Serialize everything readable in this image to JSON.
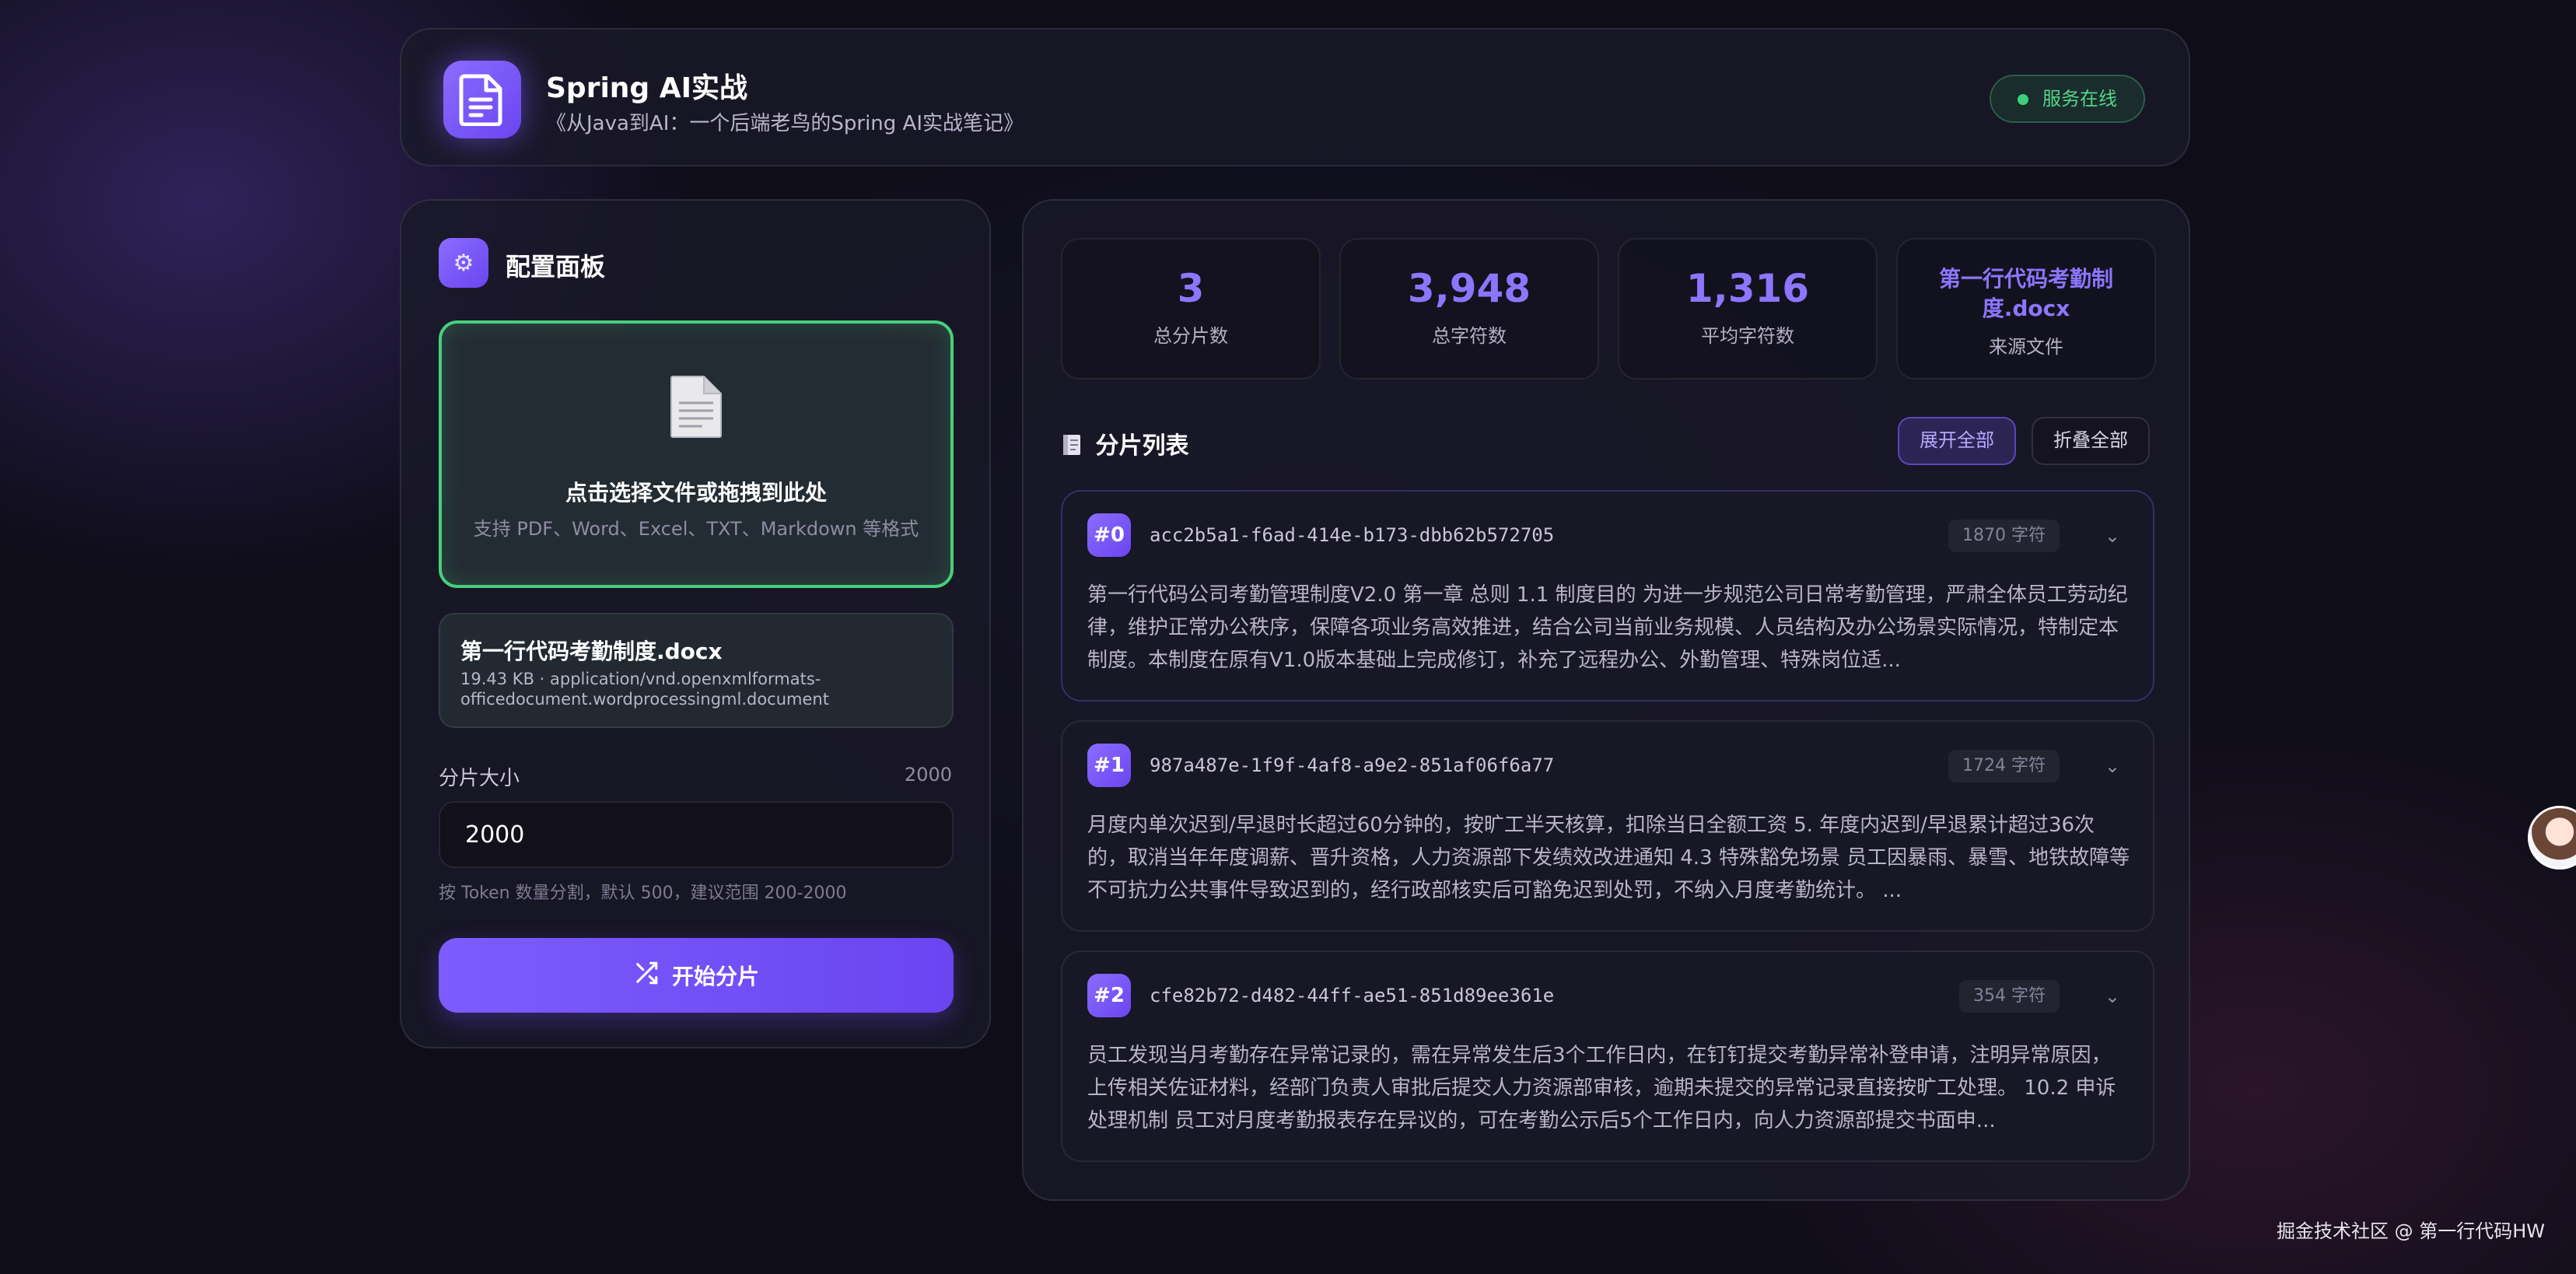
{
  "header": {
    "title": "Spring AI实战",
    "subtitle": "《从Java到AI：一个后端老鸟的Spring AI实战笔记》",
    "status": "服务在线"
  },
  "config": {
    "title": "配置面板",
    "dropzone": {
      "title": "点击选择文件或拖拽到此处",
      "hint": "支持 PDF、Word、Excel、TXT、Markdown 等格式"
    },
    "file": {
      "name": "第一行代码考勤制度.docx",
      "meta": "19.43 KB · application/vnd.openxmlformats-officedocument.wordprocessingml.document"
    },
    "chunk_size": {
      "label": "分片大小",
      "value_display": "2000",
      "input_value": "2000",
      "hint": "按 Token 数量分割，默认 500，建议范围 200-2000"
    },
    "start_label": "开始分片"
  },
  "stats": [
    {
      "value": "3",
      "label": "总分片数"
    },
    {
      "value": "3,948",
      "label": "总字符数"
    },
    {
      "value": "1,316",
      "label": "平均字符数"
    },
    {
      "value": "第一行代码考勤制度.docx",
      "label": "来源文件"
    }
  ],
  "chunk_list": {
    "title": "分片列表",
    "expand_label": "展开全部",
    "collapse_label": "折叠全部",
    "items": [
      {
        "badge": "#0",
        "id": "acc2b5a1-f6ad-414e-b173-dbb62b572705",
        "count": "1870 字符",
        "text": "第一行代码公司考勤管理制度V2.0 第一章 总则 1.1 制度目的 为进一步规范公司日常考勤管理，严肃全体员工劳动纪律，维护正常办公秩序，保障各项业务高效推进，结合公司当前业务规模、人员结构及办公场景实际情况，特制定本制度。本制度在原有V1.0版本基础上完成修订，补充了远程办公、外勤管理、特殊岗位适..."
      },
      {
        "badge": "#1",
        "id": "987a487e-1f9f-4af8-a9e2-851af06f6a77",
        "count": "1724 字符",
        "text": "月度内单次迟到/早退时长超过60分钟的，按旷工半天核算，扣除当日全额工资 5. 年度内迟到/早退累计超过36次的，取消当年年度调薪、晋升资格，人力资源部下发绩效改进通知 4.3 特殊豁免场景 员工因暴雨、暴雪、地铁故障等不可抗力公共事件导致迟到的，经行政部核实后可豁免迟到处罚，不纳入月度考勤统计。 ..."
      },
      {
        "badge": "#2",
        "id": "cfe82b72-d482-44ff-ae51-851d89ee361e",
        "count": "354 字符",
        "text": "员工发现当月考勤存在异常记录的，需在异常发生后3个工作日内，在钉钉提交考勤异常补登申请，注明异常原因，上传相关佐证材料，经部门负责人审批后提交人力资源部审核，逾期未提交的异常记录直接按旷工处理。 10.2 申诉处理机制 员工对月度考勤报表存在异议的，可在考勤公示后5个工作日内，向人力资源部提交书面申..."
      }
    ]
  },
  "footer": "掘金技术社区 @ 第一行代码HW",
  "icons": {
    "logo": "document-icon",
    "config": "gear-icon",
    "dropzone": "file-icon",
    "start": "shuffle-icon",
    "list": "notebook-icon",
    "chevron": "chevron-down-icon"
  }
}
